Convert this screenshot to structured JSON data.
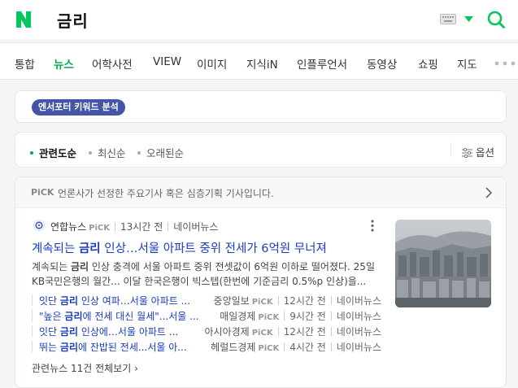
{
  "header": {
    "query": "금리",
    "brand_color": "#03c75a"
  },
  "tabs": [
    {
      "label": "통합"
    },
    {
      "label": "뉴스"
    },
    {
      "label": "어학사전"
    },
    {
      "label": "VIEW"
    },
    {
      "label": "이미지"
    },
    {
      "label": "지식iN"
    },
    {
      "label": "인플루언서"
    },
    {
      "label": "동영상"
    },
    {
      "label": "쇼핑"
    },
    {
      "label": "지도"
    }
  ],
  "active_tab": "뉴스",
  "keyword_badge": "엔서포터 키워드 분석",
  "sort": {
    "options": [
      "관련도순",
      "최신순",
      "오래된순"
    ],
    "active": "관련도순",
    "option_label": "옵션"
  },
  "pick_bar": {
    "logo": "PiCK",
    "text": "언론사가 선정한 주요기사 혹은 심층기획 기사입니다."
  },
  "article": {
    "press": "연합뉴스",
    "pick": "PiCK",
    "time": "13시간 전",
    "platform": "네이버뉴스",
    "title_pre": "계속되는 ",
    "title_kw": "금리",
    "title_post": " 인상…서울 아파트 중위 전세가 6억원 무너져",
    "desc_pre": "계속되는 ",
    "desc_kw": "금리",
    "desc_post": " 인상 충격에 서울 아파트 중위 전셋값이 6억원 이하로 떨어졌다. 25일 KB국민은행의 월간... 이달 한국은행이 빅스텝(한번에 기준금리 0.5%p 인상)을..."
  },
  "related": [
    {
      "pre": "잇단 ",
      "kw": "금리",
      "post": " 인상 여파…서울 아파트 ...",
      "press": "중앙일보",
      "pick": "PiCK",
      "time": "12시간 전",
      "platform": "네이버뉴스"
    },
    {
      "pre": "\"높은 ",
      "kw": "금리",
      "post": "에 전세 대신 월세\"...서울 ...",
      "press": "매일경제",
      "pick": "PiCK",
      "time": "9시간 전",
      "platform": "네이버뉴스"
    },
    {
      "pre": "잇단 ",
      "kw": "금리",
      "post": " 인상에…서울 아파트 ...",
      "press": "아시아경제",
      "pick": "PiCK",
      "time": "12시간 전",
      "platform": "네이버뉴스"
    },
    {
      "pre": "뛰는 ",
      "kw": "금리",
      "post": "에 잔밥된 전세...서울 아...",
      "press": "헤럴드경제",
      "pick": "PiCK",
      "time": "4시간 전",
      "platform": "네이버뉴스"
    }
  ],
  "more_related": "관련뉴스 11건 전체보기"
}
